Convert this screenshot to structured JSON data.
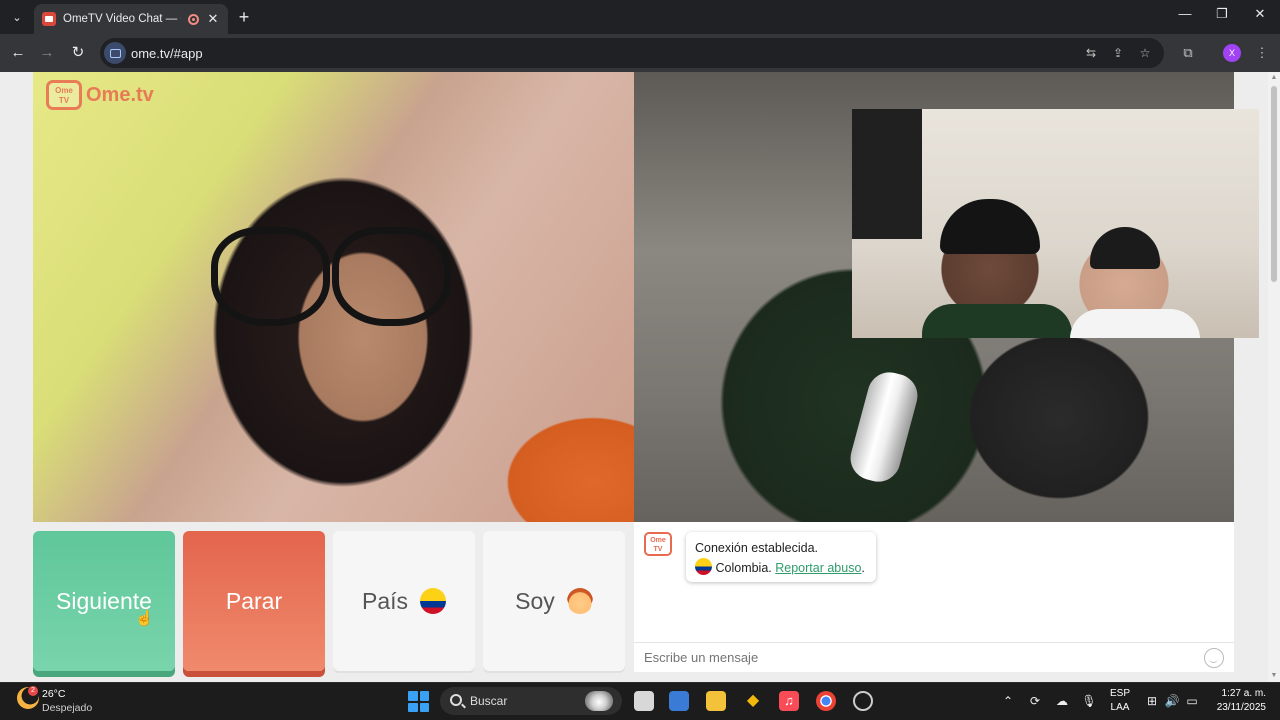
{
  "browser": {
    "tab_title": "OmeTV Video Chat — Ome",
    "new_tab": "+",
    "url": "ome.tv/#app",
    "profile_initial": "X",
    "window_controls": {
      "minimize": "—",
      "maximize": "❐",
      "close": "✕"
    }
  },
  "page": {
    "logo_box": "Ome TV",
    "logo_text": "Ome.tv",
    "buttons": {
      "next": "Siguiente",
      "stop": "Parar",
      "country": "País",
      "gender": "Soy"
    },
    "chat": {
      "logo": "Ome TV",
      "status": "Conexión establecida.",
      "country": "Colombia.",
      "report": "Reportar abuso",
      "report_suffix": ".",
      "placeholder": "Escribe un mensaje"
    }
  },
  "taskbar": {
    "weather_badge": "2",
    "weather_temp": "26°C",
    "weather_desc": "Despejado",
    "search_label": "Buscar",
    "lang_top": "ESP",
    "lang_bottom": "LAA",
    "time": "1:27 a. m.",
    "date": "23/11/2025"
  },
  "colors": {
    "next_button": "#5fc79a",
    "stop_button": "#e3654d",
    "brand": "#e86a4f",
    "link": "#2f9c6a"
  }
}
